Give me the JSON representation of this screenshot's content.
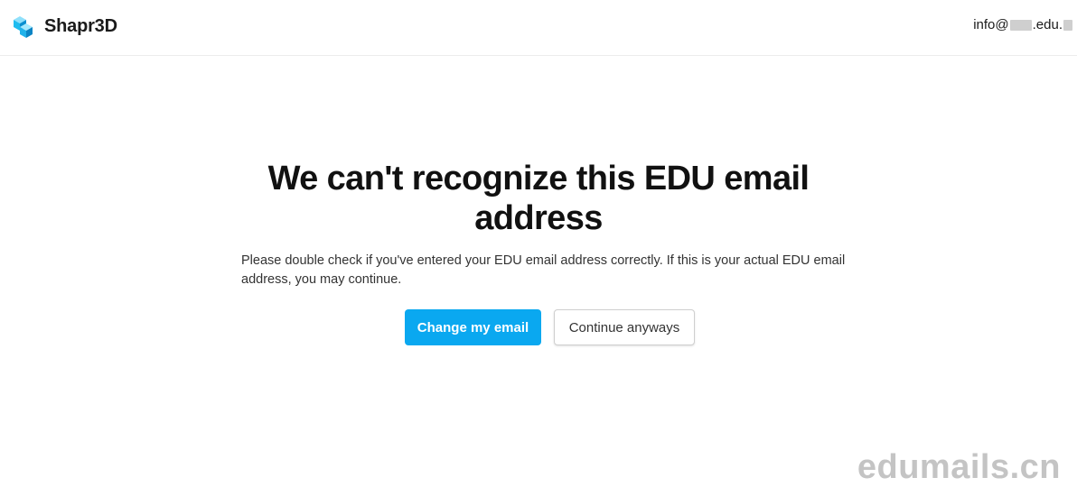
{
  "brand": {
    "name": "Shapr3D",
    "logo_icon": "shapr3d-logo-icon",
    "accent_color": "#0aa8f0"
  },
  "account": {
    "email_prefix": "info@",
    "email_middle": ".edu."
  },
  "main": {
    "title": "We can't recognize this EDU email address",
    "message": "Please double check if you've entered your EDU email address correctly. If this is your actual EDU email address, you may continue.",
    "primary_button": "Change my email",
    "secondary_button": "Continue anyways"
  },
  "watermark": "edumails.cn"
}
